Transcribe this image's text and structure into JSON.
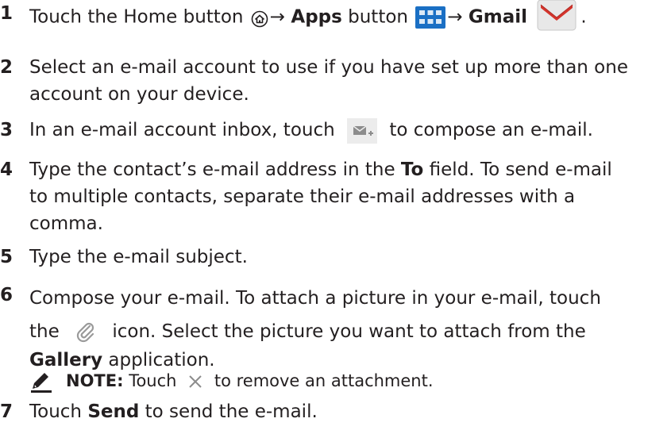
{
  "steps": [
    {
      "num": "1",
      "a": "Touch the Home button",
      "arrow1": "→",
      "apps": "Apps",
      "b": "button",
      "arrow2": "→",
      "gmail": "Gmail",
      "end": "."
    },
    {
      "num": "2",
      "line1": "Select an e-mail account to use if you have set up more than one",
      "line2": "account on your device."
    },
    {
      "num": "3",
      "a": "In an e-mail account inbox, touch",
      "b": "to compose an e-mail."
    },
    {
      "num": "4",
      "line1a": "Type the contact’s e-mail address in the",
      "to": "To",
      "line1b": "field. To send e-mail",
      "line2": "to multiple contacts, separate their e-mail addresses with a",
      "line3": "comma."
    },
    {
      "num": "5",
      "text": "Type the e-mail subject."
    },
    {
      "num": "6",
      "line1": "Compose your e-mail. To attach a picture in your e-mail, touch",
      "line2a": "the",
      "line2b": "icon. Select the picture you want to attach from the",
      "gallery": "Gallery",
      "line3": "application."
    },
    {
      "num": "7",
      "a": "Touch",
      "send": "Send",
      "b": "to send the e-mail."
    }
  ],
  "note": {
    "label": "NOTE:",
    "a": "Touch",
    "b": "to remove an attachment."
  },
  "icons": [
    "home-icon",
    "apps-icon",
    "gmail-icon",
    "compose-icon",
    "paperclip-icon",
    "pen-icon",
    "close-icon"
  ],
  "colors": {
    "text": "#231f20",
    "apps_blue": "#1a6fc4",
    "gmail_red": "#d4342c",
    "icon_gray": "#8c8c8c"
  }
}
